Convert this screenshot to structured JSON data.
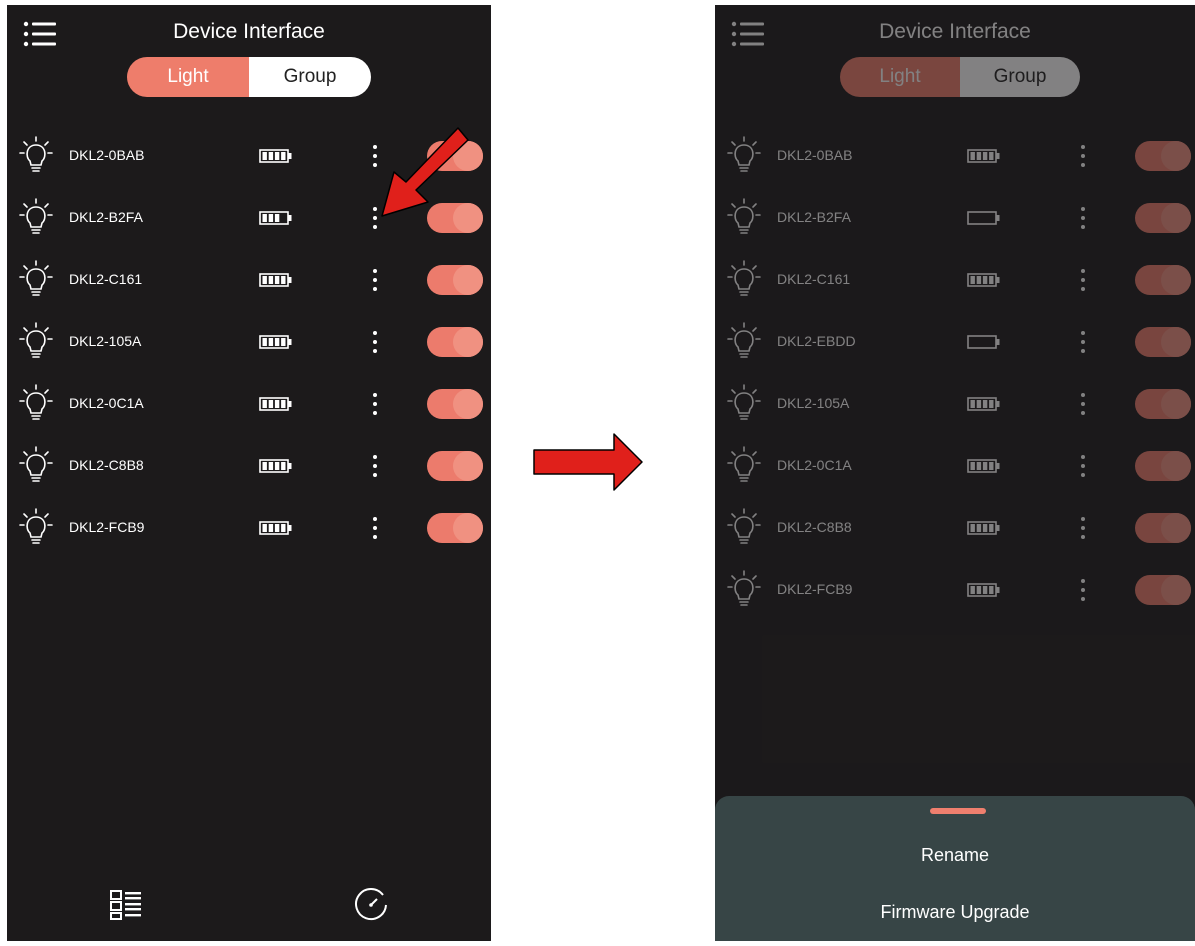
{
  "left_screen": {
    "title": "Device Interface",
    "tabs": [
      {
        "label": "Light",
        "active": true
      },
      {
        "label": "Group",
        "active": false
      }
    ],
    "devices": [
      {
        "name": "DKL2-0BAB",
        "battery_bars": 4,
        "on": true
      },
      {
        "name": "DKL2-B2FA",
        "battery_bars": 3,
        "on": true
      },
      {
        "name": "DKL2-C161",
        "battery_bars": 4,
        "on": true
      },
      {
        "name": "DKL2-105A",
        "battery_bars": 4,
        "on": true
      },
      {
        "name": "DKL2-0C1A",
        "battery_bars": 4,
        "on": true
      },
      {
        "name": "DKL2-C8B8",
        "battery_bars": 4,
        "on": true
      },
      {
        "name": "DKL2-FCB9",
        "battery_bars": 4,
        "on": true
      }
    ],
    "bottom_nav": [
      {
        "icon": "device-list-icon"
      },
      {
        "icon": "timer-icon"
      }
    ]
  },
  "right_screen": {
    "title": "Device Interface",
    "tabs": [
      {
        "label": "Light",
        "active": true
      },
      {
        "label": "Group",
        "active": false
      }
    ],
    "devices": [
      {
        "name": "DKL2-0BAB",
        "battery_bars": 4,
        "on": true
      },
      {
        "name": "DKL2-B2FA",
        "battery_bars": 0,
        "on": true
      },
      {
        "name": "DKL2-C161",
        "battery_bars": 4,
        "on": true
      },
      {
        "name": "DKL2-EBDD",
        "battery_bars": 0,
        "on": true
      },
      {
        "name": "DKL2-105A",
        "battery_bars": 4,
        "on": true
      },
      {
        "name": "DKL2-0C1A",
        "battery_bars": 4,
        "on": true
      },
      {
        "name": "DKL2-C8B8",
        "battery_bars": 4,
        "on": true
      },
      {
        "name": "DKL2-FCB9",
        "battery_bars": 4,
        "on": true
      }
    ],
    "sheet": {
      "items": [
        "Rename",
        "Firmware Upgrade"
      ]
    }
  },
  "colors": {
    "background": "#1c1a1b",
    "accent": "#ee7d6b",
    "sheet": "#374546",
    "annotation_arrow": "#e0201b"
  }
}
